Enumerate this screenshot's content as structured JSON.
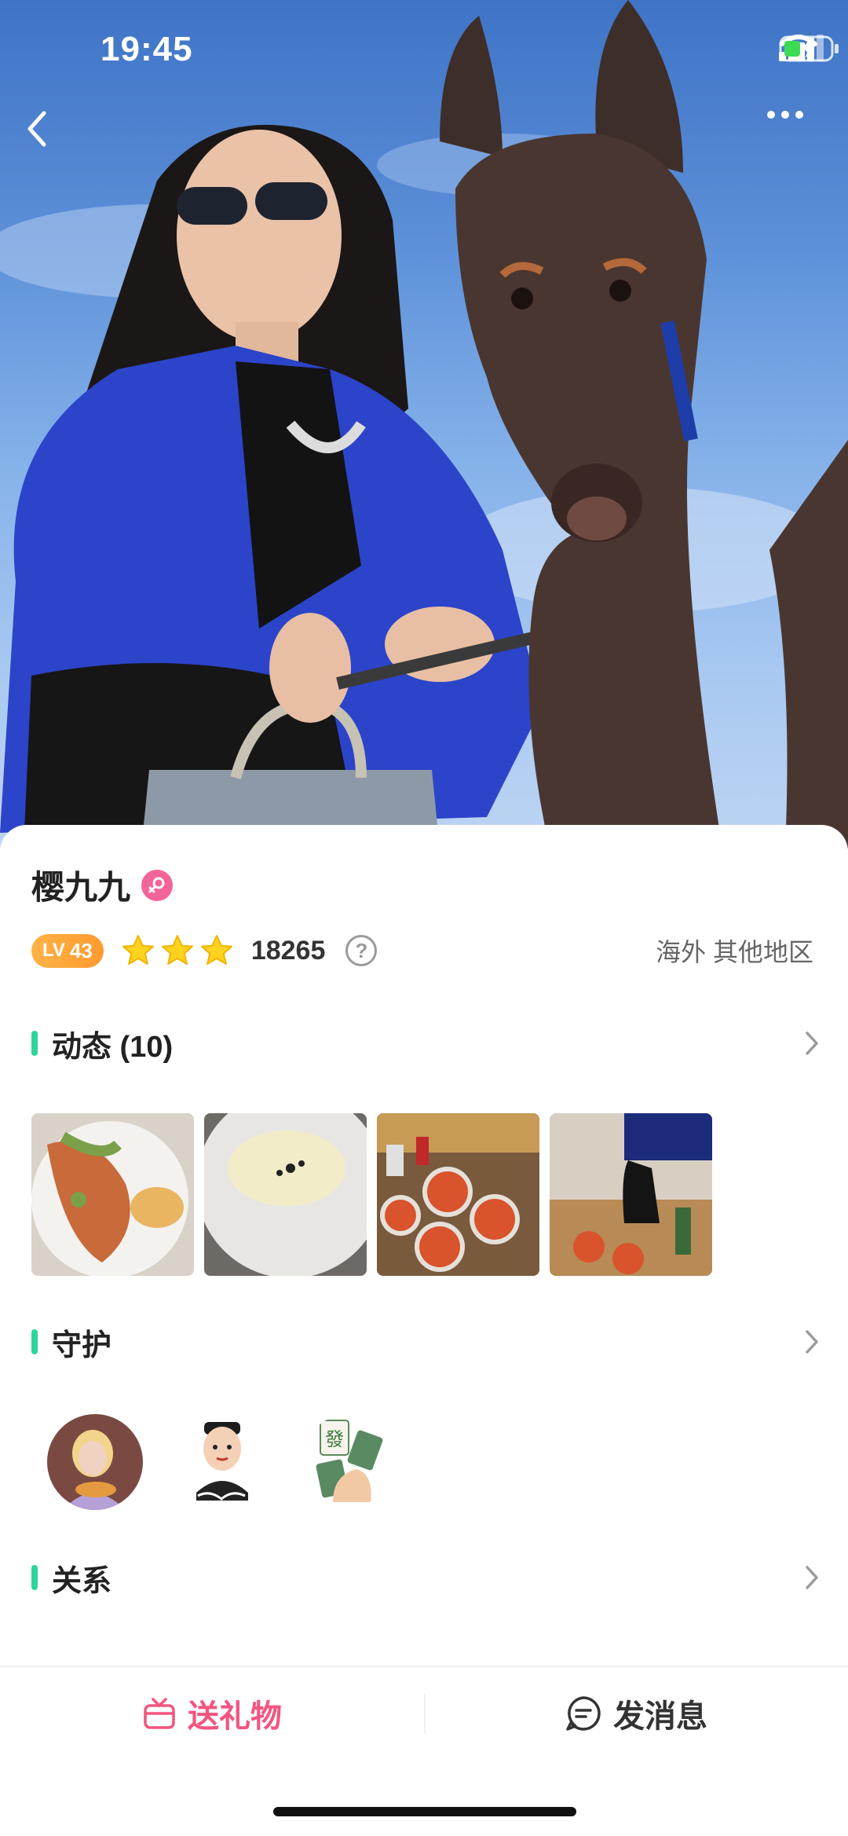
{
  "status_bar": {
    "time": "19:45"
  },
  "profile": {
    "name": "樱九九",
    "gender": "female",
    "level_prefix": "LV",
    "level": "43",
    "star_count": 3,
    "score": "18265",
    "location": "海外 其他地区"
  },
  "sections": {
    "moments": {
      "title": "动态 (10)",
      "thumbnail_count": 4
    },
    "guardians": {
      "title": "守护",
      "avatar_count": 3
    },
    "relations": {
      "title": "关系"
    }
  },
  "actions": {
    "gift": "送礼物",
    "message": "发消息"
  },
  "colors": {
    "accent_green": "#2ed59a",
    "gift_pink": "#f2557f",
    "level_orange": "#ff9a2f"
  }
}
